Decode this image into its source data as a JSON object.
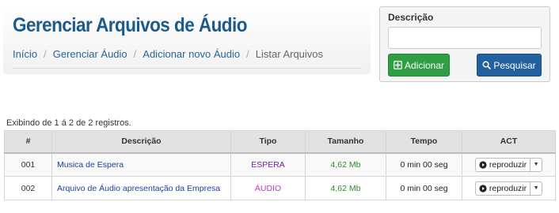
{
  "header": {
    "title": "Gerenciar Arquivos de Áudio",
    "breadcrumb": [
      "Início",
      "Gerenciar Áudio",
      "Adicionar novo Áudio",
      "Listar Arquivos"
    ]
  },
  "search": {
    "label": "Descrição",
    "value": "",
    "placeholder": "",
    "add_label": "Adicionar",
    "search_label": "Pesquisar"
  },
  "records_info": "Exibindo de 1 á 2 de 2 registros.",
  "table": {
    "columns": [
      "#",
      "Descrição",
      "Tipo",
      "Tamanho",
      "Tempo",
      "ACT"
    ],
    "rows": [
      {
        "id": "001",
        "descricao": "Musica de Espera",
        "tipo": "ESPERA",
        "tamanho": "4,62 Mb",
        "tempo": "0 min 00 seg",
        "action": "reproduzir"
      },
      {
        "id": "002",
        "descricao": "Arquivo de Áudio apresentação da Empresa",
        "tipo": "ÁUDIO",
        "tamanho": "4,62 Mb",
        "tempo": "0 min 00 seg",
        "action": "reproduzir"
      }
    ]
  },
  "colors": {
    "title": "#1d5a8c",
    "link": "#2a6496",
    "add_button": "#2f9e45",
    "search_button": "#23609f",
    "tipo_espera": "#7a1fa2",
    "tipo_audio": "#c238d0",
    "size_text": "#2e8b2e"
  },
  "icons": {
    "add": "plus-square-icon",
    "search": "search-icon",
    "play": "play-circle-icon",
    "dropdown": "caret-down-icon"
  }
}
